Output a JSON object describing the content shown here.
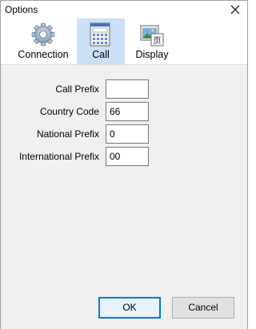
{
  "window": {
    "title": "Options"
  },
  "toolbar": {
    "tabs": [
      {
        "label": "Connection",
        "icon": "gear-icon"
      },
      {
        "label": "Call",
        "icon": "calculator-icon",
        "active": true
      },
      {
        "label": "Display",
        "icon": "display-icon"
      }
    ]
  },
  "form": {
    "fields": [
      {
        "label": "Call Prefix",
        "value": ""
      },
      {
        "label": "Country Code",
        "value": "66"
      },
      {
        "label": "National Prefix",
        "value": "0"
      },
      {
        "label": "International Prefix",
        "value": "00"
      }
    ]
  },
  "buttons": {
    "ok": "OK",
    "cancel": "Cancel"
  },
  "colors": {
    "active_tab": "#cce0f7",
    "content_bg": "#f0f0f0",
    "default_button_border": "#0078d7"
  }
}
